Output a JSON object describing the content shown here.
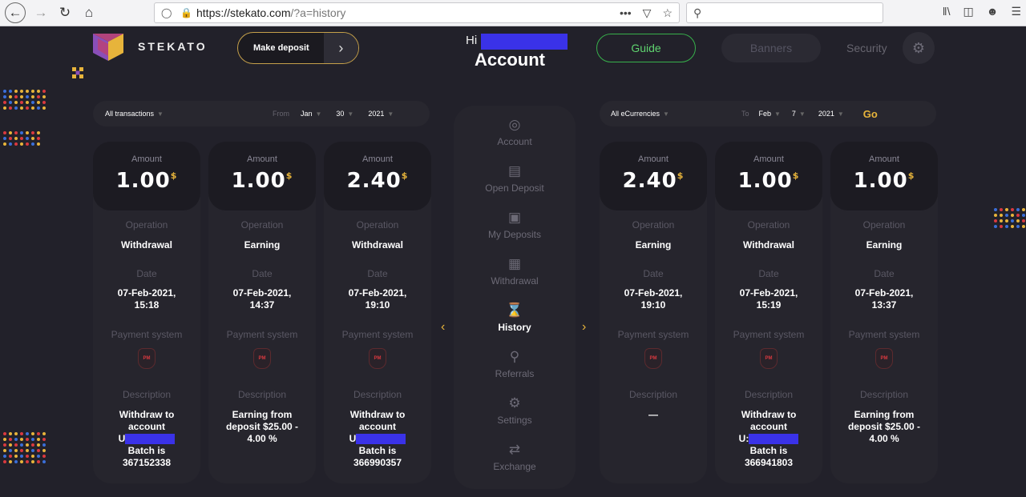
{
  "browser": {
    "url_host": "https://stekato.com",
    "url_path": "/?a=history",
    "more_icon": "•••"
  },
  "header": {
    "brand": "STEKATO",
    "make_deposit": "Make deposit",
    "greeting": "Hi",
    "title": "Account",
    "guide": "Guide",
    "banners": "Banners",
    "security": "Security"
  },
  "filter_left": {
    "type": "All transactions",
    "from_label": "From",
    "month": "Jan",
    "day": "30",
    "year": "2021"
  },
  "filter_right": {
    "type": "All eCurrencies",
    "to_label": "To",
    "month": "Feb",
    "day": "7",
    "year": "2021",
    "go": "Go"
  },
  "labels": {
    "amount": "Amount",
    "operation": "Operation",
    "date": "Date",
    "payment_system": "Payment system",
    "description": "Description",
    "currency": "$",
    "pm": "PM"
  },
  "cards": [
    {
      "amount": "1.00",
      "operation": "Withdrawal",
      "date1": "07-Feb-2021,",
      "date2": "15:18",
      "desc1": "Withdraw to",
      "desc2": "account",
      "desc3": "U",
      "desc4": "Batch is",
      "desc5": "367152338"
    },
    {
      "amount": "1.00",
      "operation": "Earning",
      "date1": "07-Feb-2021,",
      "date2": "14:37",
      "desc1": "Earning from",
      "desc2": "deposit $25.00 -",
      "desc3": "4.00 %"
    },
    {
      "amount": "2.40",
      "operation": "Withdrawal",
      "date1": "07-Feb-2021,",
      "date2": "19:10",
      "desc1": "Withdraw to",
      "desc2": "account",
      "desc3": "U",
      "desc4": "Batch is",
      "desc5": "366990357"
    },
    {
      "amount": "2.40",
      "operation": "Earning",
      "date1": "07-Feb-2021,",
      "date2": "19:10",
      "desc1": "—"
    },
    {
      "amount": "1.00",
      "operation": "Withdrawal",
      "date1": "07-Feb-2021,",
      "date2": "15:19",
      "desc1": "Withdraw to",
      "desc2": "account",
      "desc3": "U:",
      "desc4": "Batch is",
      "desc5": "366941803"
    },
    {
      "amount": "1.00",
      "operation": "Earning",
      "date1": "07-Feb-2021,",
      "date2": "13:37",
      "desc1": "Earning from",
      "desc2": "deposit $25.00 -",
      "desc3": "4.00 %"
    }
  ],
  "menu": {
    "account": "Account",
    "open_deposit": "Open Deposit",
    "my_deposits": "My Deposits",
    "withdrawal": "Withdrawal",
    "history": "History",
    "referrals": "Referrals",
    "settings": "Settings",
    "exchange": "Exchange"
  },
  "colors": {
    "accent_gold": "#e7b43b",
    "guide_green": "#37b04b",
    "redaction": "#3a32e8",
    "pm_red": "#d9393f"
  }
}
